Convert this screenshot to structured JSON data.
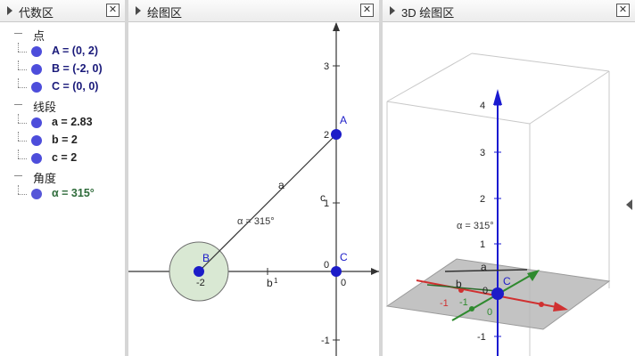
{
  "algebra": {
    "title": "代数区",
    "groups": [
      {
        "label": "点",
        "items": [
          "A = (0, 2)",
          "B = (-2, 0)",
          "C = (0, 0)"
        ]
      },
      {
        "label": "线段",
        "items": [
          "a = 2.83",
          "b = 2",
          "c = 2"
        ]
      },
      {
        "label": "角度",
        "items": [
          "α = 315°"
        ]
      }
    ]
  },
  "graphics": {
    "title": "绘图区",
    "y_ticks": [
      "3",
      "2",
      "1",
      "0",
      "-1"
    ],
    "x_ticks": [
      "-2",
      "0"
    ],
    "points": {
      "A": "A",
      "B": "B",
      "C": "C"
    },
    "segment_labels": {
      "a": "a",
      "b": "b",
      "c": "c"
    },
    "angle_label": "α = 315°",
    "colors": {
      "point": "#1c1cc8",
      "axis": "#333333",
      "angle_fill": "#d9e8d3"
    }
  },
  "graphics3d": {
    "title": "3D 绘图区",
    "z_ticks": [
      "4",
      "3",
      "2",
      "1",
      "-1"
    ],
    "angle_label": "α = 315°",
    "plane_labels": {
      "a": "a",
      "b": "b",
      "c": "C",
      "zero": "0"
    },
    "axis_ticks": {
      "x_neg1": "-1",
      "y_neg1": "-1",
      "origin0": "0"
    },
    "colors": {
      "z_axis": "#1a1ad0",
      "x_axis": "#d03030",
      "y_axis": "#2f8a2f",
      "plane": "#b4b4b4"
    }
  }
}
